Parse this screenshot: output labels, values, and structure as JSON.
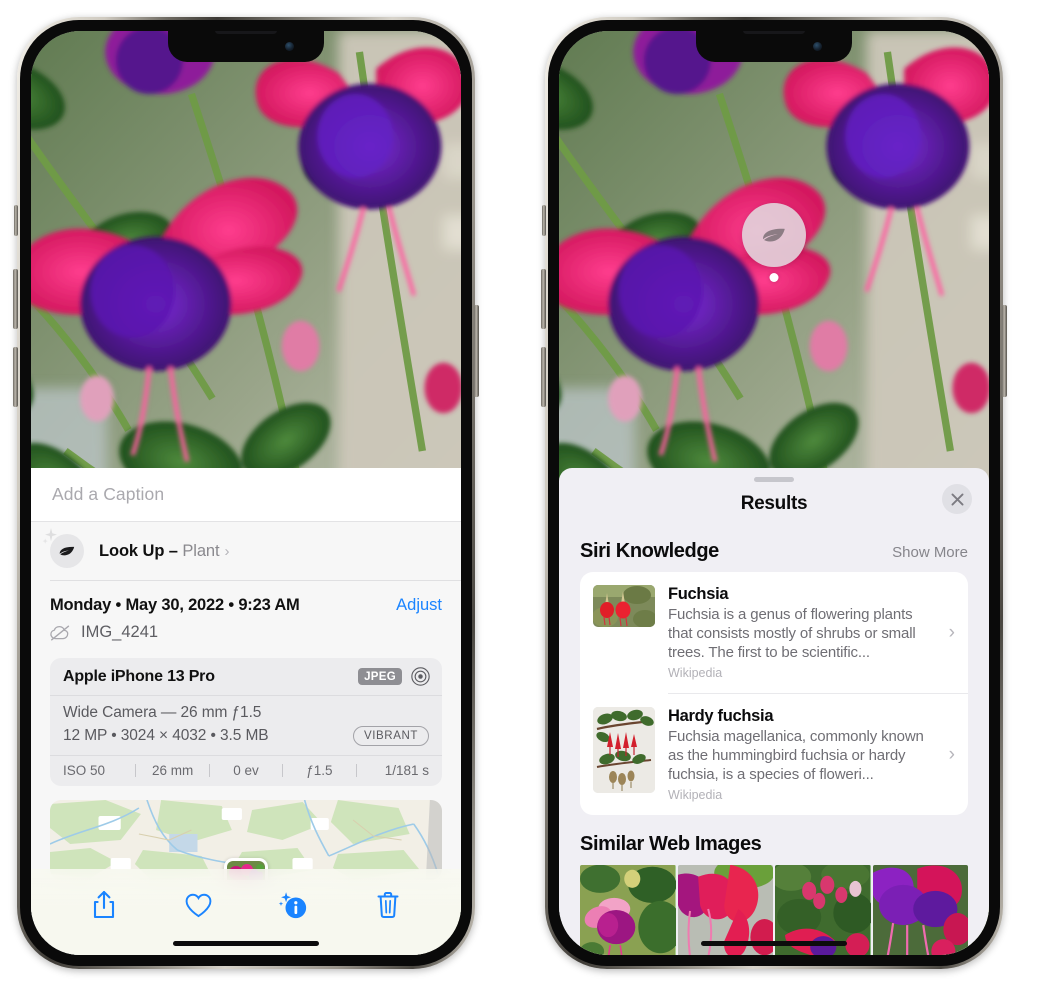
{
  "left_phone": {
    "name": "iphone-photos-info",
    "photo_alt": "fuchsia-flowers-photo",
    "caption": {
      "placeholder": "Add a Caption",
      "value": ""
    },
    "look_up": {
      "label": "Look Up",
      "separator": " – ",
      "subject": "Plant",
      "chevron": "›",
      "icon": "leaf-icon",
      "sparkle_icon": "sparkle-icon"
    },
    "metadata": {
      "datetime": "Monday • May 30, 2022 • 9:23 AM",
      "adjust_label": "Adjust",
      "filename": "IMG_4241",
      "cloud_icon": "cloud-slash-icon"
    },
    "camera_card": {
      "device": "Apple iPhone 13 Pro",
      "format_badge": "JPEG",
      "raw_icon": "raw-ring-icon",
      "lens_line": "Wide Camera — 26 mm ƒ1.5",
      "size_line": "12 MP • 3024 × 4032 • 3.5 MB",
      "style_badge": "VIBRANT",
      "exif": [
        "ISO 50",
        "26 mm",
        "0 ev",
        "ƒ1.5",
        "1/181 s"
      ]
    },
    "map": {
      "name": "location-map",
      "pin_thumb": "photo-thumbnail"
    },
    "toolbar": [
      {
        "name": "share-button",
        "icon": "share-icon"
      },
      {
        "name": "favorite-button",
        "icon": "heart-icon"
      },
      {
        "name": "info-button",
        "icon": "info-sparkle-icon"
      },
      {
        "name": "delete-button",
        "icon": "trash-icon"
      }
    ],
    "accent_color": "#1a84ff"
  },
  "right_phone": {
    "name": "iphone-visual-lookup-results",
    "photo_alt": "fuchsia-flowers-photo",
    "vlu_badge": {
      "icon": "leaf-icon",
      "name": "visual-lookup-badge"
    },
    "sheet": {
      "title": "Results",
      "close_icon": "close-icon",
      "siri_knowledge": {
        "title": "Siri Knowledge",
        "show_more": "Show More",
        "items": [
          {
            "title": "Fuchsia",
            "description": "Fuchsia is a genus of flowering plants that consists mostly of shrubs or small trees. The first to be scientific...",
            "source": "Wikipedia",
            "thumb": "fuchsia-red-flowers-thumb",
            "chevron": "›"
          },
          {
            "title": "Hardy fuchsia",
            "description": "Fuchsia magellanica, commonly known as the hummingbird fuchsia or hardy fuchsia, is a species of floweri...",
            "source": "Wikipedia",
            "thumb": "hardy-fuchsia-branch-thumb",
            "chevron": "›"
          }
        ]
      },
      "similar_web_images": {
        "title": "Similar Web Images",
        "items": [
          {
            "name": "web-image-1"
          },
          {
            "name": "web-image-2"
          },
          {
            "name": "web-image-3"
          },
          {
            "name": "web-image-4"
          }
        ]
      }
    }
  }
}
